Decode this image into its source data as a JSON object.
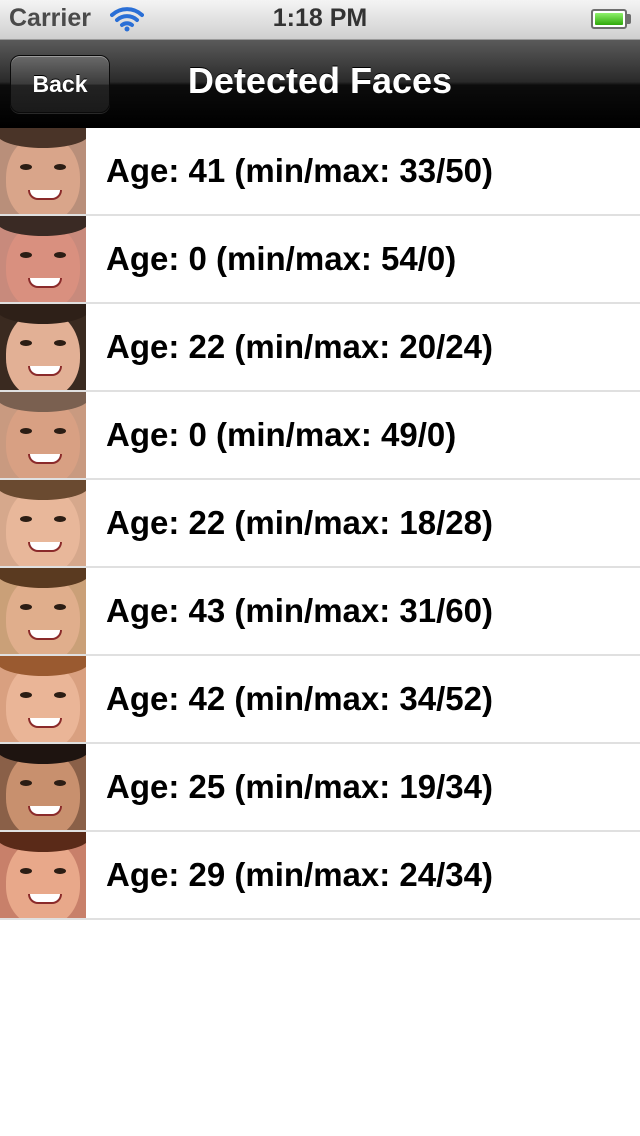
{
  "status_bar": {
    "carrier": "Carrier",
    "time": "1:18 PM",
    "wifi_icon": "wifi-icon",
    "battery_icon": "battery-icon"
  },
  "nav": {
    "back_label": "Back",
    "title": "Detected Faces"
  },
  "faces": [
    {
      "label": "Age: 41 (min/max: 33/50)",
      "skin": "#d9a58a",
      "hair": "#4a3428",
      "bg": "#b98f7a"
    },
    {
      "label": "Age: 0 (min/max: 54/0)",
      "skin": "#d9907f",
      "hair": "#3a2a24",
      "bg": "#c88a7c"
    },
    {
      "label": "Age: 22 (min/max: 20/24)",
      "skin": "#e2b095",
      "hair": "#2e2018",
      "bg": "#3a2a20"
    },
    {
      "label": "Age: 0 (min/max: 49/0)",
      "skin": "#d8a083",
      "hair": "#7a6050",
      "bg": "#c99a80"
    },
    {
      "label": "Age: 22 (min/max: 18/28)",
      "skin": "#e8b79a",
      "hair": "#6a4a30",
      "bg": "#d6a88c"
    },
    {
      "label": "Age: 43 (min/max: 31/60)",
      "skin": "#e0ae8c",
      "hair": "#5a3a20",
      "bg": "#caa078"
    },
    {
      "label": "Age: 42 (min/max: 34/52)",
      "skin": "#eab597",
      "hair": "#9a5a30",
      "bg": "#d9a080"
    },
    {
      "label": "Age: 25 (min/max: 19/34)",
      "skin": "#c8906e",
      "hair": "#1e1410",
      "bg": "#8a6048"
    },
    {
      "label": "Age: 29 (min/max: 24/34)",
      "skin": "#e8a88a",
      "hair": "#5a2a18",
      "bg": "#c8806a"
    }
  ]
}
